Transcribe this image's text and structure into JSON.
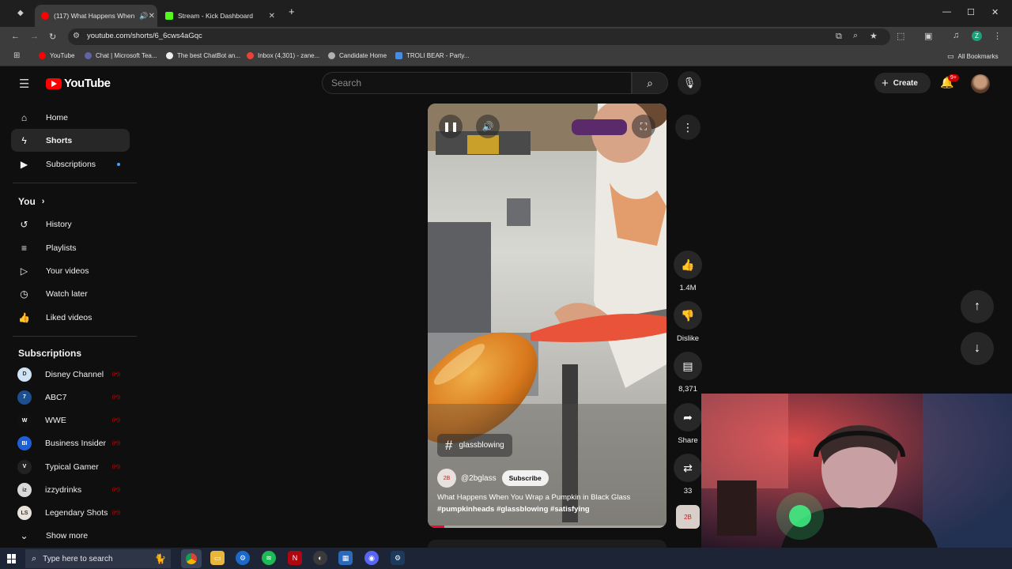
{
  "browser": {
    "tabs": [
      {
        "title": "(117) What Happens When",
        "active": true
      },
      {
        "title": "Stream - Kick Dashboard",
        "active": false
      }
    ],
    "new_tab": "+",
    "url": "youtube.com/shorts/6_6cws4aGqc",
    "bookmarks": [
      "YouTube",
      "Chat | Microsoft Tea...",
      "The best ChatBot an...",
      "Inbox (4,301) - zane...",
      "Candidate Home",
      "TROLI BEAR - Party..."
    ],
    "all_bookmarks": "All Bookmarks",
    "profile_initial": "Z"
  },
  "masthead": {
    "logo_text": "YouTube",
    "search_placeholder": "Search",
    "create_label": "Create",
    "notification_badge": "9+"
  },
  "sidebar": {
    "main": [
      {
        "label": "Home",
        "icon": "home-icon"
      },
      {
        "label": "Shorts",
        "icon": "shorts-icon",
        "active": true
      },
      {
        "label": "Subscriptions",
        "icon": "subscriptions-icon"
      }
    ],
    "you_heading": "You",
    "you": [
      {
        "label": "History",
        "icon": "history-icon"
      },
      {
        "label": "Playlists",
        "icon": "playlists-icon"
      },
      {
        "label": "Your videos",
        "icon": "your-videos-icon"
      },
      {
        "label": "Watch later",
        "icon": "watch-later-icon"
      },
      {
        "label": "Liked videos",
        "icon": "liked-videos-icon"
      }
    ],
    "subs_heading": "Subscriptions",
    "subscriptions": [
      {
        "label": "Disney Channel",
        "color": "#cfe3f5",
        "mark": "D"
      },
      {
        "label": "ABC7",
        "color": "#1d4e8f",
        "mark": "7"
      },
      {
        "label": "WWE",
        "color": "#111111",
        "mark": "W"
      },
      {
        "label": "Business Insider",
        "color": "#1f5fd6",
        "mark": "BI"
      },
      {
        "label": "Typical Gamer",
        "color": "#222222",
        "mark": "V"
      },
      {
        "label": "izzydrinks",
        "color": "#d9d9d9",
        "mark": "iz"
      },
      {
        "label": "Legendary Shots",
        "color": "#e9e2da",
        "mark": "LS"
      }
    ],
    "show_more": "Show more"
  },
  "short": {
    "hashtag_chip": "glassblowing",
    "channel": "@2bglass",
    "subscribe_label": "Subscribe",
    "title": "What Happens When You Wrap a Pumpkin in Black Glass",
    "hashtags": "#pumpkinheads #glassblowing #satisfying",
    "progress": 0.07,
    "channel_avatar_text": "2B"
  },
  "actions": {
    "likes": "1.4M",
    "dislike_label": "Dislike",
    "comments": "8,371",
    "share_label": "Share",
    "remix_count": "33"
  },
  "taskbar": {
    "search_placeholder": "Type here to search"
  },
  "colors": {
    "brand_red": "#ff0000",
    "live_red": "#ee0000",
    "new_dot": "#3ea6ff"
  }
}
